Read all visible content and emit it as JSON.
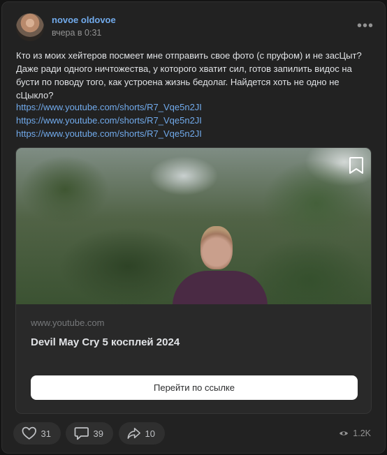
{
  "post": {
    "author": "novoe oldovoe",
    "date": "вчера в 0:31",
    "text": "Кто из моих хейтеров посмеет мне отправить свое фото (с пруфом) и не засЦыт? Даже ради одного ничтожества, у которого хватит сил, готов запилить видос на бусти по поводу того, как устроена жизнь бедолаг. Найдется хоть не одно не сЦыкло?",
    "links": [
      "https://www.youtube.com/shorts/R7_Vqe5n2JI",
      "https://www.youtube.com/shorts/R7_Vqe5n2JI",
      "https://www.youtube.com/shorts/R7_Vqe5n2JI"
    ]
  },
  "card": {
    "domain": "www.youtube.com",
    "title": "Devil May Cry 5 косплей 2024",
    "button_label": "Перейти по ссылке"
  },
  "actions": {
    "likes": "31",
    "comments": "39",
    "shares": "10",
    "views": "1.2K"
  },
  "icons": {
    "more": "more-dots-icon",
    "bookmark": "bookmark-icon",
    "like": "heart-icon",
    "comment": "comment-icon",
    "share": "share-icon",
    "views": "eye-icon"
  },
  "colors": {
    "background": "#222222",
    "link": "#71aaeb",
    "text": "#e1e3e6",
    "muted": "#939393",
    "button_bg": "#ffffff"
  }
}
